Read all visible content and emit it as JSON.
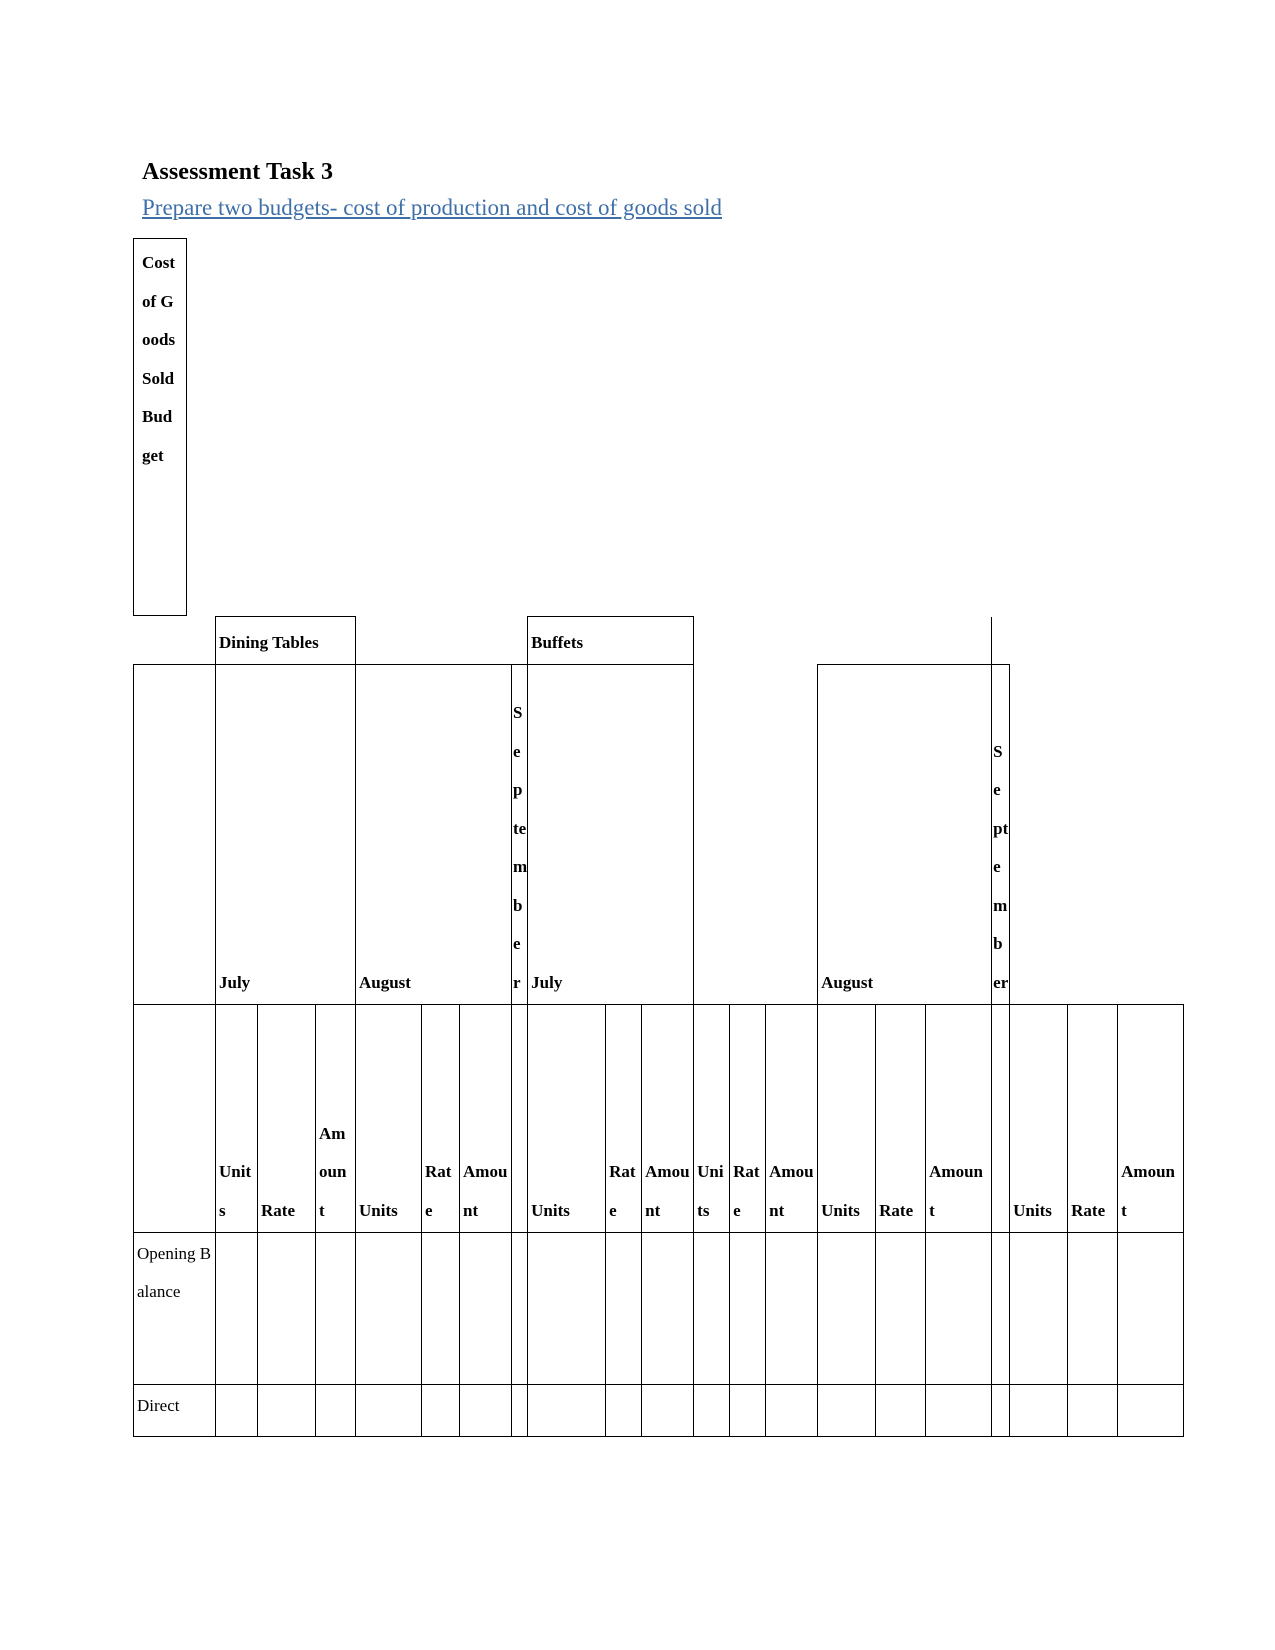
{
  "document": {
    "title": "Assessment Task 3",
    "subtitle": "Prepare two budgets- cost of production and cost of goods sold"
  },
  "table": {
    "caption": "Cost of Goods Sold Budget",
    "product_groups": [
      "Dining Tables",
      "Buffets"
    ],
    "months": [
      "July",
      "August",
      "September"
    ],
    "measure_headers": [
      "Units",
      "Rate",
      "Amount"
    ],
    "column_headers_rendered": [
      "Units",
      "Rate",
      "Amount",
      "Units",
      "Rate",
      "Amount",
      "Units",
      "Rate",
      "Amount",
      "Units",
      "Rate",
      "Amount",
      "Units",
      "Rate",
      "Amount",
      "Units",
      "Rate",
      "Amount"
    ],
    "row_labels": [
      "Opening Balance",
      "Direct"
    ],
    "rows": [
      {
        "label": "Opening Balance",
        "cells": [
          "",
          "",
          "",
          "",
          "",
          "",
          "",
          "",
          "",
          "",
          "",
          "",
          "",
          "",
          "",
          "",
          "",
          ""
        ]
      },
      {
        "label": "Direct",
        "cells": [
          "",
          "",
          "",
          "",
          "",
          "",
          "",
          "",
          "",
          "",
          "",
          "",
          "",
          "",
          "",
          "",
          "",
          ""
        ]
      }
    ]
  },
  "colors": {
    "text": "#000000",
    "link": "#3f6fa8",
    "border": "#000000",
    "background": "#ffffff"
  }
}
